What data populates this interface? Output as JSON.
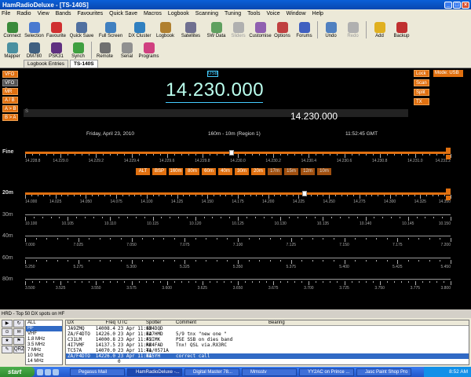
{
  "window": {
    "title": "HamRadioDeluxe - [TS-140S]"
  },
  "menu": [
    "File",
    "Radio",
    "View",
    "Bands",
    "Favourites",
    "Quick Save",
    "Macros",
    "Logbook",
    "Scanning",
    "Tuning",
    "Tools",
    "Voice",
    "Window",
    "Help"
  ],
  "toolbar1": [
    {
      "label": "Connect",
      "icon": "connect-icon",
      "color": "#3a8a3a"
    },
    {
      "label": "Selection",
      "icon": "selection-icon",
      "color": "#4a7ad0"
    },
    {
      "label": "Favourite",
      "icon": "heart-icon",
      "color": "#d03030"
    },
    {
      "label": "Quick Save",
      "icon": "disk-icon",
      "color": "#5070a0"
    },
    {
      "label": "Full Screen",
      "icon": "monitor-icon",
      "color": "#4080c0"
    },
    {
      "label": "DX Cluster",
      "icon": "globe-icon",
      "color": "#3080c0"
    },
    {
      "label": "Logbook",
      "icon": "book-icon",
      "color": "#b08030"
    },
    {
      "label": "Satellites",
      "icon": "satellite-icon",
      "color": "#707090"
    },
    {
      "label": "SW Data",
      "icon": "chart-icon",
      "color": "#60a060"
    },
    {
      "label": "Sliders",
      "icon": "sliders-icon",
      "color": "#b0b0b0"
    },
    {
      "label": "Customise",
      "icon": "brush-icon",
      "color": "#9060b0"
    },
    {
      "label": "Options",
      "icon": "wrench-icon",
      "color": "#c04040"
    },
    {
      "label": "Forums",
      "icon": "house-icon",
      "color": "#4060c0"
    },
    {
      "label": "Undo",
      "icon": "undo-icon",
      "color": "#5080c0"
    },
    {
      "label": "Redo",
      "icon": "redo-icon",
      "color": "#b0b0b0"
    },
    {
      "label": "Add",
      "icon": "star-icon",
      "color": "#e0b020"
    },
    {
      "label": "Backup",
      "icon": "backup-icon",
      "color": "#c03030"
    }
  ],
  "toolbar2": [
    {
      "label": "Mapper",
      "icon": "map-icon",
      "color": "#4a90a0"
    },
    {
      "label": "DM780",
      "icon": "dm780-icon",
      "color": "#406080"
    },
    {
      "label": "PSK31",
      "icon": "psk31-icon",
      "color": "#603080"
    },
    {
      "label": "Synch",
      "icon": "synch-icon",
      "color": "#40a040"
    },
    {
      "label": "Remote",
      "icon": "remote-icon",
      "color": "#707070"
    },
    {
      "label": "Serial",
      "icon": "serial-icon",
      "color": "#909090"
    },
    {
      "label": "Programs",
      "icon": "programs-icon",
      "color": "#d04080"
    }
  ],
  "tabs": [
    "Logbook Entries",
    "TS-140S"
  ],
  "radio": {
    "left_buttons": [
      "VFO A",
      "VFO B",
      "MR",
      "A / B",
      "A > B",
      "B > A"
    ],
    "mode_badge": "USB",
    "main_freq": "14.230.000",
    "sub_freq": "14.230.000",
    "smeter_label": "S",
    "right_buttons": [
      "Lock",
      "Scan",
      "Split",
      "TX"
    ],
    "mode_select": "Mode: USB",
    "date": "Friday, April 23, 2010",
    "band_range": "160m - 10m (Region 1)",
    "time": "11:52:45 GMT",
    "fine_label": "Fine",
    "bands": [
      "ALT",
      "BSP",
      "160m",
      "80m",
      "60m",
      "40m",
      "30m",
      "20m",
      "17m",
      "15m",
      "12m",
      "10m"
    ],
    "scales": [
      {
        "label": "Fine",
        "ticks": [
          "14.228.8",
          "14.229.0",
          "14.229.2",
          "14.229.4",
          "14.229.6",
          "14.229.8",
          "14.230.0",
          "14.230.2",
          "14.230.4",
          "14.230.6",
          "14.230.8",
          "14.231.0",
          "14.231.2"
        ],
        "marker": 0.485
      },
      {
        "label": "20m",
        "ticks": [
          "14.000",
          "14.025",
          "14.050",
          "14.075",
          "14.100",
          "14.125",
          "14.150",
          "14.175",
          "14.200",
          "14.225",
          "14.250",
          "14.275",
          "14.300",
          "14.325",
          "14.350"
        ],
        "marker": 0.657
      },
      {
        "label": "30m",
        "ticks": [
          "10.100",
          "10.105",
          "10.110",
          "10.115",
          "10.120",
          "10.125",
          "10.130",
          "10.135",
          "10.140",
          "10.145",
          "10.150"
        ]
      },
      {
        "label": "40m",
        "ticks": [
          "7.000",
          "7.025",
          "7.050",
          "7.075",
          "7.100",
          "7.125",
          "7.150",
          "7.175",
          "7.200"
        ]
      },
      {
        "label": "60m",
        "ticks": [
          "5.250",
          "5.275",
          "5.300",
          "5.325",
          "5.350",
          "5.375",
          "5.400",
          "5.425",
          "5.450"
        ]
      },
      {
        "label": "80m",
        "ticks": [
          "3.500",
          "3.525",
          "3.550",
          "3.575",
          "3.600",
          "3.625",
          "3.650",
          "3.675",
          "3.700",
          "3.725",
          "3.750",
          "3.775",
          "3.800"
        ]
      }
    ]
  },
  "dx": {
    "title": "HRD - Top 50 DX spots on HF",
    "icons": [
      "▶",
      "↻",
      "⊙",
      "✉",
      "★",
      "⚑",
      "✎",
      "QRZ"
    ],
    "bands": [
      "ALL",
      "HF",
      "VHF",
      "1.8 MHz",
      "3.5 MHz",
      "7 MHz",
      "10 MHz",
      "14 MHz"
    ],
    "selected_band": 1,
    "headers": [
      "DX",
      "Freq",
      "UTC",
      "Spotter",
      "Comment",
      "Bearing"
    ],
    "rows": [
      [
        "JA9ZMQ",
        "14008.4",
        "23 Apr 11:42",
        "SM4DQD",
        "",
        ""
      ],
      [
        "ZA/F4DTO",
        "14226.0",
        "23 Apr 11:42",
        "EA7HMD",
        "5/9 tnx \"new one \"",
        ""
      ],
      [
        "C31LM",
        "14000.8",
        "23 Apr 11:42",
        "F5IMK",
        "PSE SSB on dies band",
        ""
      ],
      [
        "4I7VMF",
        "14137.5",
        "23 Apr 11:42",
        "RK4FAD",
        "Tnx! QSL via.RX3RC",
        ""
      ],
      [
        "TC57A",
        "14070.0",
        "23 Apr 11:41",
        "TA/0571A",
        "",
        ""
      ],
      [
        "ZA/F4DTO",
        "14226.0",
        "23 Apr 11:41",
        "EA5YH",
        "correct call",
        ""
      ],
      [
        "",
        "",
        "0",
        "",
        "",
        ""
      ]
    ],
    "selected_row": 5
  },
  "taskbar": {
    "start": "start",
    "tasks": [
      "Pegasus Mail",
      "HamRadioDeluxe -...",
      "Digital Master 78...",
      "Mmsstv",
      "YY2AC on Prince ...",
      "Jasc Paint Shop Pro"
    ],
    "active_task": 1,
    "clock": "8:52 AM"
  }
}
